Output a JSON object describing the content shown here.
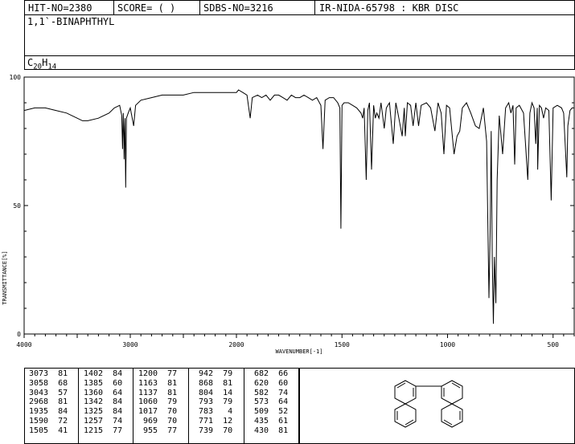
{
  "header": {
    "hit_no": "HIT-NO=2380",
    "score": "SCORE=  (   )",
    "sdbs_no": "SDBS-NO=3216",
    "ir_nida": "IR-NIDA-65798 : KBR DISC"
  },
  "compound": {
    "name": "1,1`-BINAPHTHYL",
    "formula_parts": [
      "C",
      "20",
      "H",
      "14"
    ]
  },
  "chart_data": {
    "type": "line",
    "xlabel": "WAVENUMBER[-1]",
    "ylabel": "TRANSMITTANCE[%]",
    "xlim": [
      4000,
      400
    ],
    "ylim": [
      0,
      100
    ],
    "x_ticks": [
      "4000",
      "3000",
      "2000",
      "1500",
      "1000",
      "500"
    ],
    "y_ticks": [
      "100",
      "50",
      "0"
    ],
    "line_color": "#000000",
    "series": [
      {
        "x": [
          4000,
          3900,
          3800,
          3700,
          3600,
          3500,
          3450,
          3400,
          3300,
          3200,
          3150,
          3100,
          3080,
          3073,
          3066,
          3060,
          3058,
          3050,
          3043,
          3036,
          3020,
          3000,
          2968,
          2950,
          2900,
          2800,
          2700,
          2600,
          2500,
          2400,
          2300,
          2200,
          2100,
          2000,
          1990,
          1970,
          1950,
          1935,
          1925,
          1900,
          1880,
          1860,
          1840,
          1820,
          1800,
          1780,
          1760,
          1740,
          1720,
          1700,
          1680,
          1660,
          1640,
          1620,
          1600,
          1590,
          1580,
          1560,
          1540,
          1520,
          1510,
          1505,
          1500,
          1490,
          1470,
          1450,
          1430,
          1410,
          1402,
          1395,
          1385,
          1378,
          1370,
          1360,
          1350,
          1342,
          1335,
          1325,
          1315,
          1300,
          1290,
          1275,
          1257,
          1245,
          1235,
          1215,
          1205,
          1200,
          1190,
          1175,
          1163,
          1150,
          1137,
          1125,
          1100,
          1080,
          1060,
          1045,
          1030,
          1017,
          1005,
          990,
          969,
          955,
          942,
          930,
          910,
          890,
          868,
          850,
          830,
          815,
          804,
          798,
          793,
          788,
          783,
          778,
          771,
          765,
          755,
          739,
          725,
          710,
          700,
          690,
          682,
          675,
          660,
          640,
          620,
          610,
          600,
          590,
          582,
          575,
          573,
          565,
          555,
          545,
          535,
          520,
          509,
          500,
          480,
          460,
          450,
          435,
          430,
          420,
          410,
          400
        ],
        "y": [
          87,
          88,
          88,
          87,
          86,
          84,
          83,
          83,
          84,
          86,
          88,
          89,
          85,
          72,
          86,
          76,
          68,
          84,
          57,
          84,
          86,
          88,
          81,
          89,
          91,
          92,
          93,
          93,
          93,
          94,
          94,
          94,
          94,
          94,
          95,
          94,
          93,
          84,
          92,
          93,
          92,
          93,
          91,
          93,
          93,
          92,
          91,
          93,
          92,
          92,
          93,
          92,
          91,
          92,
          89,
          72,
          91,
          92,
          92,
          90,
          88,
          41,
          89,
          90,
          90,
          89,
          88,
          86,
          84,
          88,
          60,
          87,
          90,
          64,
          89,
          84,
          86,
          84,
          90,
          80,
          88,
          90,
          74,
          90,
          86,
          77,
          88,
          77,
          90,
          89,
          81,
          90,
          81,
          89,
          90,
          88,
          79,
          90,
          86,
          70,
          89,
          88,
          70,
          77,
          79,
          88,
          90,
          86,
          81,
          80,
          88,
          75,
          14,
          40,
          79,
          30,
          4,
          30,
          12,
          60,
          85,
          70,
          88,
          90,
          86,
          89,
          66,
          88,
          89,
          86,
          60,
          86,
          90,
          88,
          74,
          88,
          64,
          89,
          88,
          84,
          88,
          87,
          52,
          88,
          89,
          88,
          86,
          61,
          81,
          87,
          88,
          88
        ]
      }
    ]
  },
  "peak_table": [
    [
      [
        "3073",
        "81"
      ],
      [
        "3058",
        "68"
      ],
      [
        "3043",
        "57"
      ],
      [
        "2968",
        "81"
      ],
      [
        "1935",
        "84"
      ],
      [
        "1590",
        "72"
      ],
      [
        "1505",
        "41"
      ]
    ],
    [
      [
        "1402",
        "84"
      ],
      [
        "1385",
        "60"
      ],
      [
        "1360",
        "64"
      ],
      [
        "1342",
        "84"
      ],
      [
        "1325",
        "84"
      ],
      [
        "1257",
        "74"
      ],
      [
        "1215",
        "77"
      ]
    ],
    [
      [
        "1200",
        "77"
      ],
      [
        "1163",
        "81"
      ],
      [
        "1137",
        "81"
      ],
      [
        "1060",
        "79"
      ],
      [
        "1017",
        "70"
      ],
      [
        "969",
        "70"
      ],
      [
        "955",
        "77"
      ]
    ],
    [
      [
        "942",
        "79"
      ],
      [
        "868",
        "81"
      ],
      [
        "804",
        "14"
      ],
      [
        "793",
        "79"
      ],
      [
        "783",
        "4"
      ],
      [
        "771",
        "12"
      ],
      [
        "739",
        "70"
      ]
    ],
    [
      [
        "682",
        "66"
      ],
      [
        "620",
        "60"
      ],
      [
        "582",
        "74"
      ],
      [
        "573",
        "64"
      ],
      [
        "509",
        "52"
      ],
      [
        "435",
        "61"
      ],
      [
        "430",
        "81"
      ]
    ]
  ]
}
